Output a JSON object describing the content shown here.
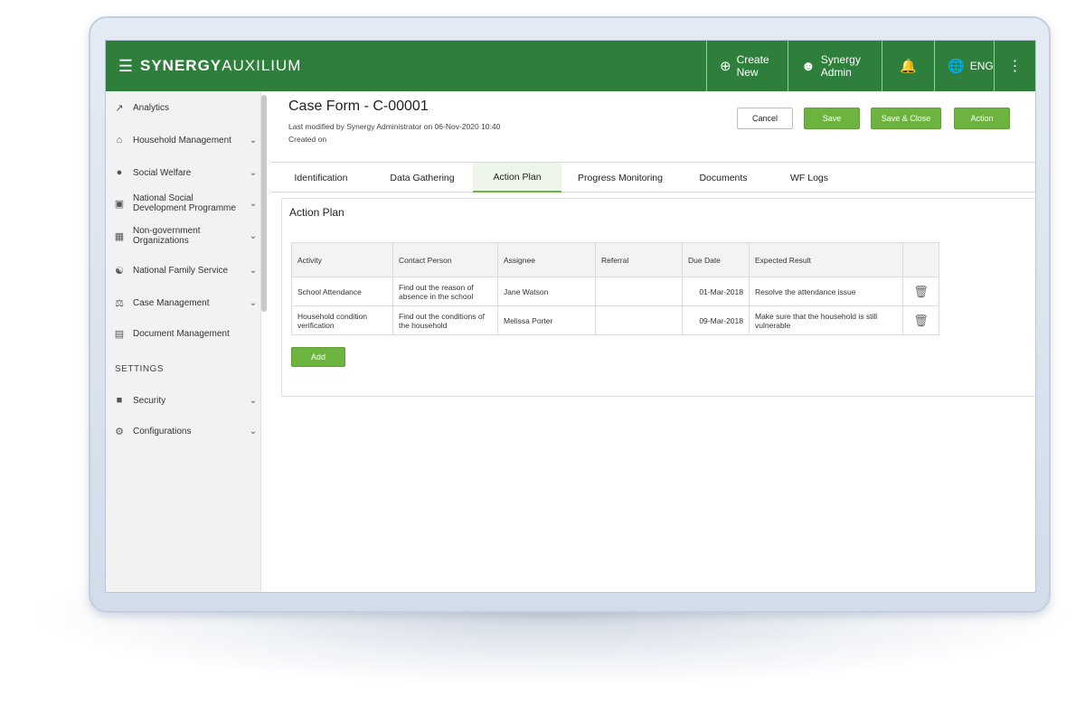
{
  "header": {
    "logo_main": "SYNERGY",
    "logo_light": "AUXILIUM",
    "create_new": "Create New",
    "user": "Synergy Admin",
    "language": "ENG"
  },
  "sidebar": {
    "items": [
      {
        "label": "Analytics",
        "icon": "chart-icon"
      },
      {
        "label": "Household Management",
        "icon": "home-icon"
      },
      {
        "label": "Social Welfare",
        "icon": "people-icon"
      },
      {
        "label": "National Social Development Programme",
        "icon": "bank-icon"
      },
      {
        "label": "Non-government Organizations",
        "icon": "building-icon"
      },
      {
        "label": "National Family Service",
        "icon": "family-icon"
      },
      {
        "label": "Case Management",
        "icon": "scale-icon"
      },
      {
        "label": "Document Management",
        "icon": "documents-icon"
      }
    ],
    "settings_heading": "SETTINGS",
    "settings_items": [
      {
        "label": "Security",
        "icon": "lock-icon"
      },
      {
        "label": "Configurations",
        "icon": "gear-icon"
      }
    ]
  },
  "case": {
    "title": "Case Form - C-00001",
    "last_modified": "Last modified by Synergy Administrator on 06-Nov-2020 10:40",
    "created_on": "Created on"
  },
  "actions": {
    "cancel": "Cancel",
    "save": "Save",
    "save_close": "Save & Close",
    "action": "Action"
  },
  "tabs": [
    "Identification",
    "Data Gathering",
    "Action Plan",
    "Progress Monitoring",
    "Documents",
    "WF Logs"
  ],
  "active_tab": "Action Plan",
  "action_plan": {
    "title": "Action Plan",
    "columns": [
      "Activity",
      "Contact Person",
      "Assignee",
      "Referral",
      "Due Date",
      "Expected Result"
    ],
    "rows": [
      {
        "activity": "School Attendance",
        "contact_person": "Find out the reason of absence in the school",
        "assignee": "Jane Watson",
        "referral": "",
        "due_date": "01-Mar-2018",
        "expected_result": "Resolve the attendance issue"
      },
      {
        "activity": "Household condition verification",
        "contact_person": "Find out the conditions of the household",
        "assignee": "Melissa Porter",
        "referral": "",
        "due_date": "09-Mar-2018",
        "expected_result": "Make sure that the household is still vulnerable"
      }
    ],
    "add_label": "Add"
  },
  "colors": {
    "header_green": "#2f7f3c",
    "button_green": "#6db33f"
  }
}
